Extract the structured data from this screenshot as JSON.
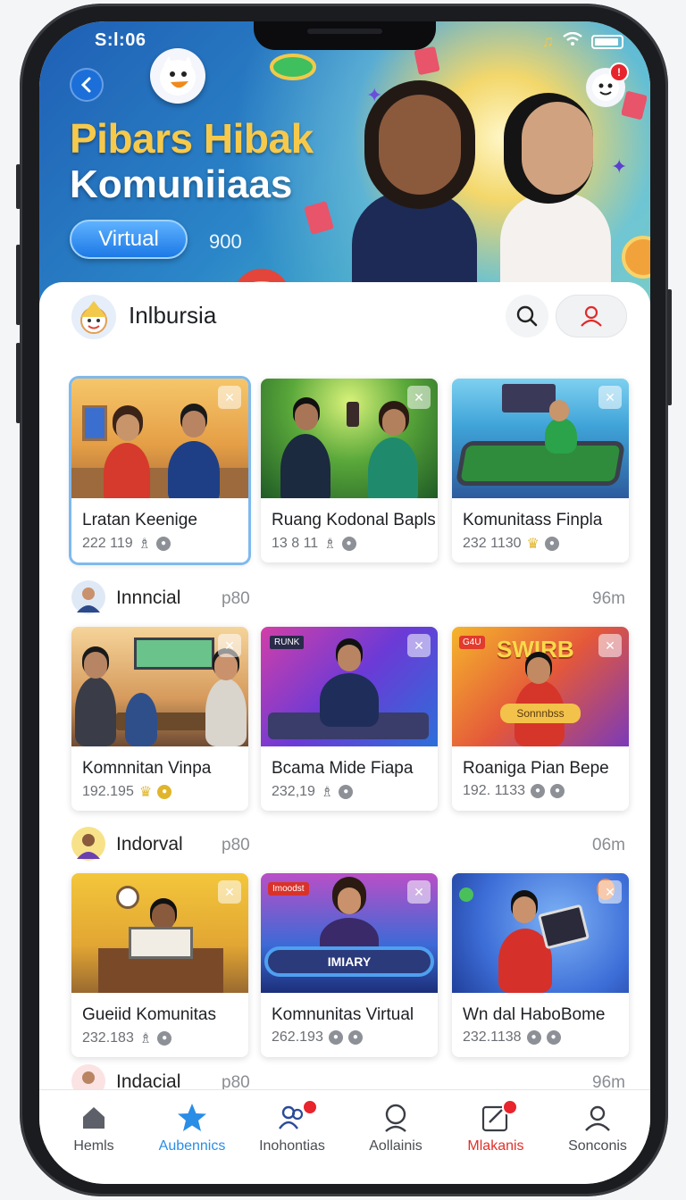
{
  "status": {
    "time": "S:l:06"
  },
  "hero": {
    "title_line1": "Pibars Hibak",
    "title_line2": "Komuniiaas",
    "button_label": "Virtual",
    "count": "900"
  },
  "header": {
    "app_name": "Inlbursia"
  },
  "sections": [
    {
      "cards": [
        {
          "title": "Lratan Keenige",
          "meta": "222 119"
        },
        {
          "title": "Ruang Kodonal Bapls",
          "meta": "13 8 11"
        },
        {
          "title": "Komunitass Finpla",
          "meta": "232 1130"
        }
      ]
    },
    {
      "name": "Innncial",
      "sub": "p80",
      "time": "96m",
      "cards": [
        {
          "title": "Komnnitan Vinpa",
          "meta": "192.195"
        },
        {
          "title": "Bcama Mide Fiapa",
          "meta": "232,19"
        },
        {
          "title": "Roaniga Pian Bepe",
          "meta": "192. 1133"
        }
      ]
    },
    {
      "name": "Indorval",
      "sub": "p80",
      "time": "06m",
      "cards": [
        {
          "title": "Gueiid Komunitas",
          "meta": "232.183"
        },
        {
          "title": "Komnunitas  Virtual",
          "meta": "262.193"
        },
        {
          "title": "Wn dal HaboBome",
          "meta": "232.1138"
        }
      ]
    },
    {
      "name": "Indacial",
      "sub": "p80",
      "time": "96m"
    }
  ],
  "thumb_labels": {
    "neon_sign": "RUNK",
    "party_banner": "SWIRB",
    "party_sub": "Sonnnbss",
    "party_tag": "G4U",
    "stage_sign": "Imoodst",
    "stage_board": "IMIARY"
  },
  "tabs": [
    {
      "label": "Hemls",
      "icon": "home-icon"
    },
    {
      "label": "Aubennics",
      "icon": "star-icon",
      "active": true
    },
    {
      "label": "Inohontias",
      "icon": "community-icon",
      "badge": true
    },
    {
      "label": "Aollainis",
      "icon": "search-icon"
    },
    {
      "label": "Mlakanis",
      "icon": "edit-icon",
      "badge": true,
      "highlight": true
    },
    {
      "label": "Sonconis",
      "icon": "profile-icon"
    }
  ],
  "colors": {
    "accent": "#1c79e6",
    "active_tab": "#2a8de6",
    "alert": "#e8242c",
    "title_gold": "#f7c94a"
  }
}
